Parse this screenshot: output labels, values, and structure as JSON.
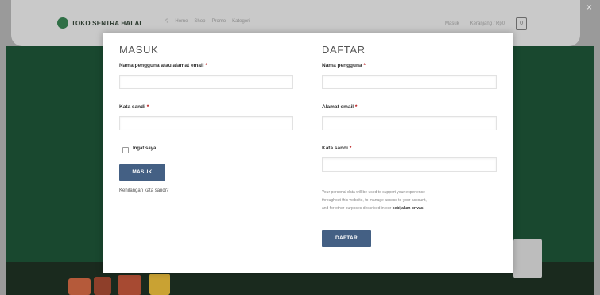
{
  "header": {
    "logo_text": "TOKO SENTRA HALAL",
    "nav": [
      "Home",
      "Shop",
      "Promo",
      "Kategori"
    ],
    "right_link1": "Masuk",
    "right_link2": "Keranjang / Rp0",
    "cart_count": "0"
  },
  "login": {
    "heading": "MASUK",
    "username_label": "Nama pengguna atau alamat email",
    "password_label": "Kata sandi",
    "required_mark": "*",
    "remember_label": "Ingat saya",
    "button": "MASUK",
    "lost_password": "Kehilangan kata sandi?"
  },
  "register": {
    "heading": "DAFTAR",
    "username_label": "Nama pengguna",
    "email_label": "Alamat email",
    "password_label": "Kata sandi",
    "required_mark": "*",
    "policy_text_1": "Your personal data will be used to support your experience",
    "policy_text_2": "throughout this website, to manage access to your account,",
    "policy_text_3": "and for other purposes described in our",
    "policy_link": "kebijakan privasi",
    "button": "DAFTAR"
  },
  "colors": {
    "button": "#446084",
    "hero": "#19482f"
  }
}
